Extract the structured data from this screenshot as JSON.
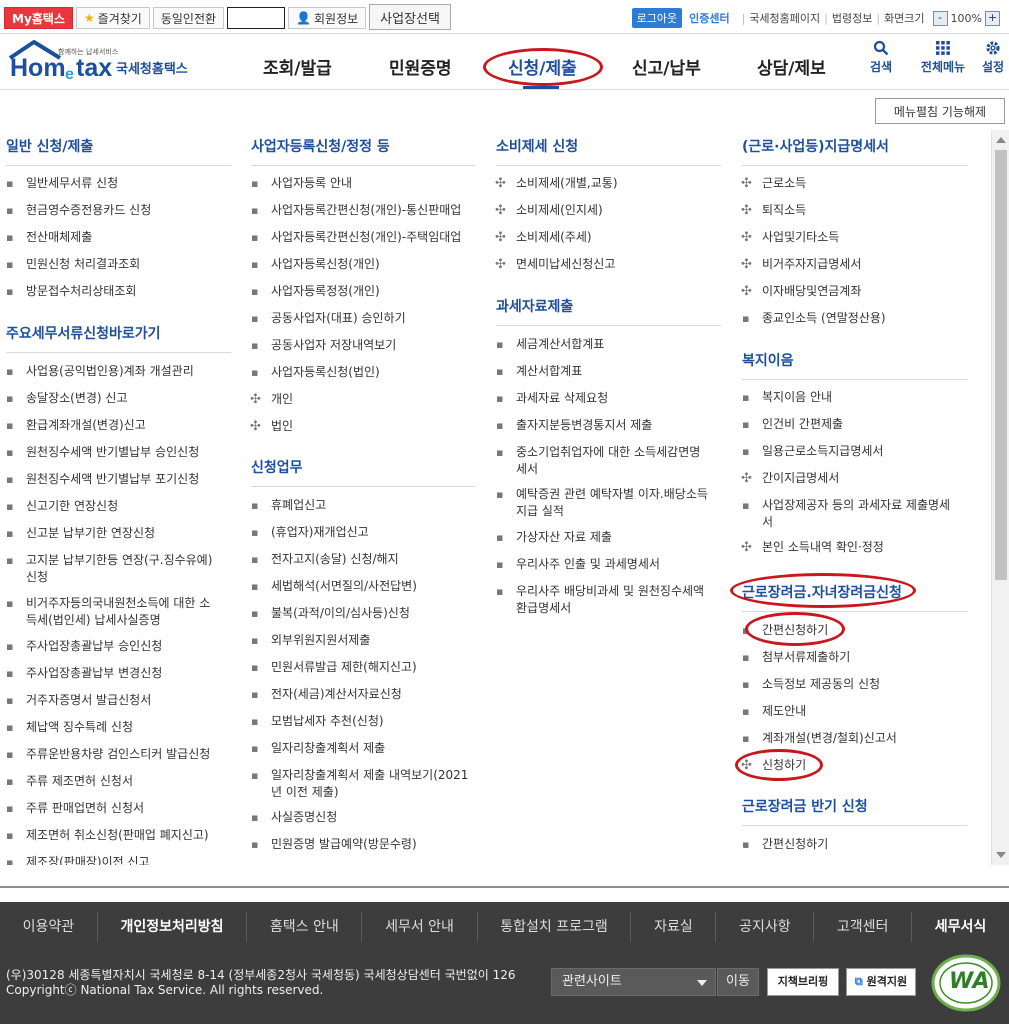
{
  "topbar": {
    "my_hometax": "My홈택스",
    "favorites": "즐겨찾기",
    "same_screen": "동일인전환",
    "member_info": "회원정보",
    "biz_select": "사업장선택",
    "logout": "로그아웃",
    "cert_center": "인증센터",
    "nts_home": "국세청홈페이지",
    "law_info": "법령정보",
    "screen_size": "화면크기",
    "zoom_minus": "-",
    "zoom_value": "100%",
    "zoom_plus": "+"
  },
  "header": {
    "logo_small": "함께하는 납세서비스",
    "logo_text": "Hometax",
    "logo_kr": "국세청홈택스",
    "gnb": [
      "조회/발급",
      "민원증명",
      "신청/제출",
      "신고/납부",
      "상담/제보"
    ],
    "search": "검색",
    "all_menu": "전체메뉴",
    "settings": "설정"
  },
  "menu_toggle": "메뉴펼침 기능해제",
  "columns": {
    "c1": {
      "s1": {
        "title": "일반 신청/제출",
        "items": [
          "일반세무서류 신청",
          "현금영수증전용카드 신청",
          "전산매체제출",
          "민원신청 처리결과조회",
          "방문접수처리상태조회"
        ]
      },
      "s2": {
        "title": "주요세무서류신청바로가기",
        "items": [
          "사업용(공익법인용)계좌 개설관리",
          "송달장소(변경) 신고",
          "환급계좌개설(변경)신고",
          "원천징수세액 반기별납부 승인신청",
          "원천징수세액 반기별납부 포기신청",
          "신고기한 연장신청",
          "신고분 납부기한 연장신청",
          "고지분 납부기한등 연장(구.징수유예)\n신청",
          "비거주자등의국내원천소득에 대한 소\n득세(법인세) 납세사실증명",
          "주사업장총괄납부 승인신청",
          "주사업장총괄납부 변경신청",
          "거주자증명서 발급신청서",
          "체납액 징수특례 신청",
          "주류운반용차량 검인스티커 발급신청",
          "주류 제조면허 신청서",
          "주류 판매업면허 신청서",
          "제조면허 취소신청(판매업 폐지신고)",
          "제조장(판매장)이전 신고"
        ]
      }
    },
    "c2": {
      "s1": {
        "title": "사업자등록신청/정정 등",
        "items": [
          "사업자등록 안내",
          "사업자등록간편신청(개인)-통신판매업",
          "사업자등록간편신청(개인)-주택임대업",
          "사업자등록신청(개인)",
          "사업자등록정정(개인)",
          "공동사업자(대표) 승인하기",
          "공동사업자 저장내역보기",
          "사업자등록신청(법인)",
          "개인",
          "법인"
        ]
      },
      "s2": {
        "title": "신청업무",
        "items": [
          "휴폐업신고",
          "(휴업자)재개업신고",
          "전자고지(송달) 신청/해지",
          "세법해석(서면질의/사전답변)",
          "불복(과적/이의/심사등)신청",
          "외부위원지원서제출",
          "민원서류발급 제한(해지신고)",
          "전자(세금)계산서자료신청",
          "모범납세자 추천(신청)",
          "일자리창출계획서 제출",
          "일자리창출계획서 제출 내역보기(2021\n년 이전 제출)",
          "사실증명신청",
          "민원증명 발급예약(방문수령)"
        ]
      }
    },
    "c3": {
      "s1": {
        "title": "소비제세 신청",
        "items": [
          "소비제세(개별,교통)",
          "소비제세(인지세)",
          "소비제세(주세)",
          "면세미납세신청신고"
        ]
      },
      "s2": {
        "title": "과세자료제출",
        "items": [
          "세금계산서합계표",
          "계산서합계표",
          "과세자료 삭제요청",
          "출자지분등변경통지서 제출",
          "중소기업취업자에 대한 소득세감면명\n세서",
          "예탁증권 관련 예탁자별 이자.배당소득\n지급 실적",
          "가상자산 자료 제출",
          "우리사주 인출 및 과세명세서",
          "우리사주 배당비과세 및 원천징수세액\n환급명세서"
        ]
      }
    },
    "c4": {
      "s1": {
        "title": "(근로·사업등)지급명세서",
        "items": [
          "근로소득",
          "퇴직소득",
          "사업및기타소득",
          "비거주자지급명세서",
          "이자배당및연금계좌",
          "종교인소득 (연말정산용)"
        ]
      },
      "s2": {
        "title": "복지이음",
        "items": [
          "복지이음 안내",
          "인건비 간편제출",
          "일용근로소득지급명세서",
          "간이지급명세서",
          "사업장제공자 등의 과세자료 제출명세\n서",
          "본인 소득내역 확인·정정"
        ]
      },
      "s3": {
        "title": "근로장려금.자녀장려금신청",
        "items": [
          "간편신청하기",
          "첨부서류제출하기",
          "소득정보 제공동의 신청",
          "제도안내",
          "계좌개설(변경/철회)신고서",
          "신청하기"
        ]
      },
      "s4": {
        "title": "근로장려금 반기 신청",
        "items": [
          "간편신청하기"
        ]
      }
    }
  },
  "footer": {
    "nav": [
      "이용약관",
      "개인정보처리방침",
      "홈택스 안내",
      "세무서 안내",
      "통합설치 프로그램",
      "자료실",
      "공지사항",
      "고객센터",
      "세무서식"
    ],
    "address": "(우)30128 세종특별자치시 국세청로 8-14 (정부세종2청사 국세청동) 국세청상담센터 국번없이 126",
    "copyright": "Copyrightⓒ National Tax Service. All rights reserved.",
    "related_sites": "관련사이트",
    "go": "이동",
    "badge1": "지책브리핑",
    "badge2": "원격지원",
    "wa_mark": "WA"
  },
  "colors": {
    "accent": "#1d4f9c",
    "highlight": "#c8171d",
    "my_hometax": "#e8383d",
    "logout": "#2e7bd6",
    "footer_bg": "#3d3d3d"
  }
}
